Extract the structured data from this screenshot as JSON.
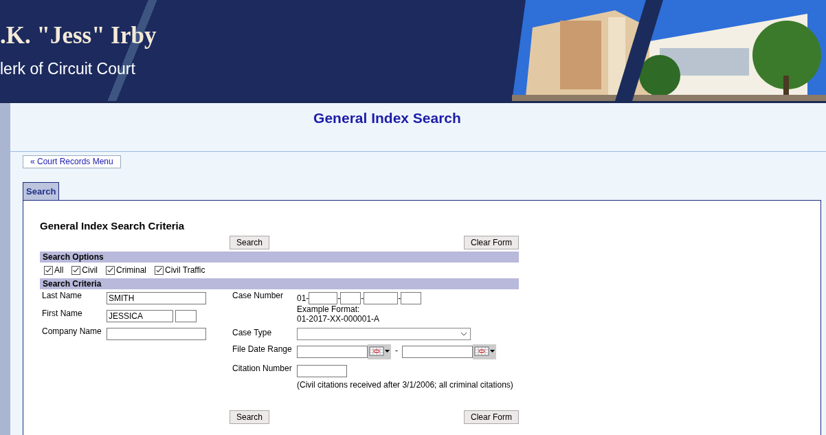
{
  "header": {
    "title": ".K. \"Jess\" Irby",
    "subtitle": "lerk of Circuit Court"
  },
  "page_title": "General Index Search",
  "back_link": "« Court Records Menu",
  "tabs": [
    {
      "label": "Search",
      "selected": true
    }
  ],
  "form": {
    "heading": "General Index Search Criteria",
    "top_buttons": [
      "Search",
      "Clear Form"
    ],
    "options_heading": "Search Options",
    "options": [
      {
        "label": "All",
        "checked": true
      },
      {
        "label": "Civil",
        "checked": true
      },
      {
        "label": "Criminal",
        "checked": true
      },
      {
        "label": "Civil Traffic",
        "checked": true
      }
    ],
    "criteria_heading": "Search Criteria",
    "last_name": {
      "label": "Last Name",
      "value": "SMITH"
    },
    "first_name": {
      "label": "First Name",
      "value": "JESSICA"
    },
    "company_name": {
      "label": "Company Name"
    },
    "case_number": {
      "label": "Case Number",
      "prefix": "01-",
      "separators": [
        "-",
        "-",
        "-"
      ],
      "hint": [
        "Example Format:",
        "01-2017-XX-000001-A"
      ]
    },
    "case_type": {
      "label": "Case Type"
    },
    "file_date_range": {
      "label": "File Date Range",
      "separator": "-"
    },
    "citation_number": {
      "label": "Citation Number",
      "note": "(Civil citations received after 3/1/2006; all criminal citations)"
    },
    "bottom_buttons": [
      "Search",
      "Clear Form"
    ]
  }
}
